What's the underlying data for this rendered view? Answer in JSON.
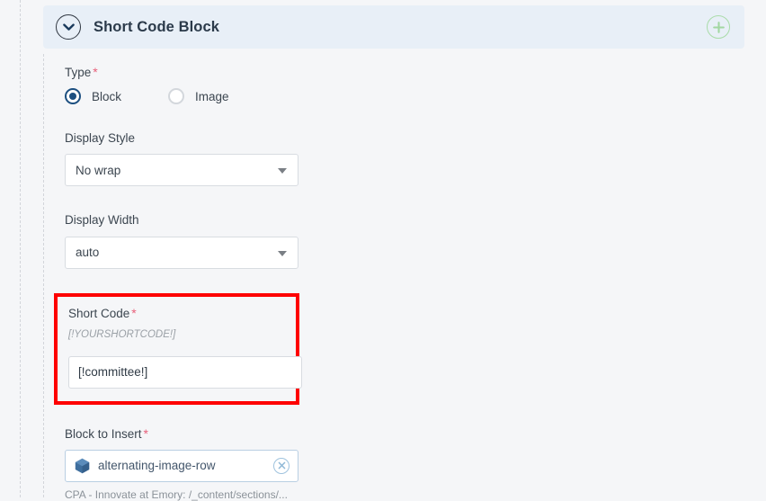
{
  "rails": {
    "outer_name": "outer-guide-rail",
    "inner_name": "inner-guide-rail"
  },
  "block_panel": {
    "title": "Short Code Block",
    "collapse_icon": "chevron-down-icon",
    "add_icon": "plus-icon",
    "header_bg": "#e8eff7",
    "add_icon_color": "#a9dca9"
  },
  "fields": {
    "type": {
      "label": "Type",
      "required_marker": "*",
      "options": [
        {
          "label": "Block",
          "selected": true
        },
        {
          "label": "Image",
          "selected": false
        }
      ],
      "selected_color": "#1c4f80"
    },
    "display_style": {
      "label": "Display Style",
      "required_marker": "",
      "value": "No wrap",
      "arrow_icon": "caret-down-icon"
    },
    "display_width": {
      "label": "Display Width",
      "required_marker": "",
      "value": "auto",
      "arrow_icon": "caret-down-icon"
    },
    "short_code": {
      "label": "Short Code",
      "required_marker": "*",
      "hint": "[!YOURSHORTCODE!]",
      "value": "[!committee!]",
      "placeholder": "",
      "highlight_color": "#fe0000"
    },
    "block_to_insert": {
      "label": "Block to Insert",
      "required_marker": "*",
      "value": "alternating-image-row",
      "block_icon": "cube-icon",
      "clear_icon": "clear-circle-x-icon",
      "path_hint": "CPA - Innovate at Emory: /_content/sections/..."
    }
  },
  "colors": {
    "page_background": "#f5f6f8",
    "label_text": "#3c4650",
    "required_star": "#e8607a",
    "input_border": "#d8dce1",
    "picker_border": "#b9cfe3",
    "hint_text": "#9aa0a6"
  }
}
